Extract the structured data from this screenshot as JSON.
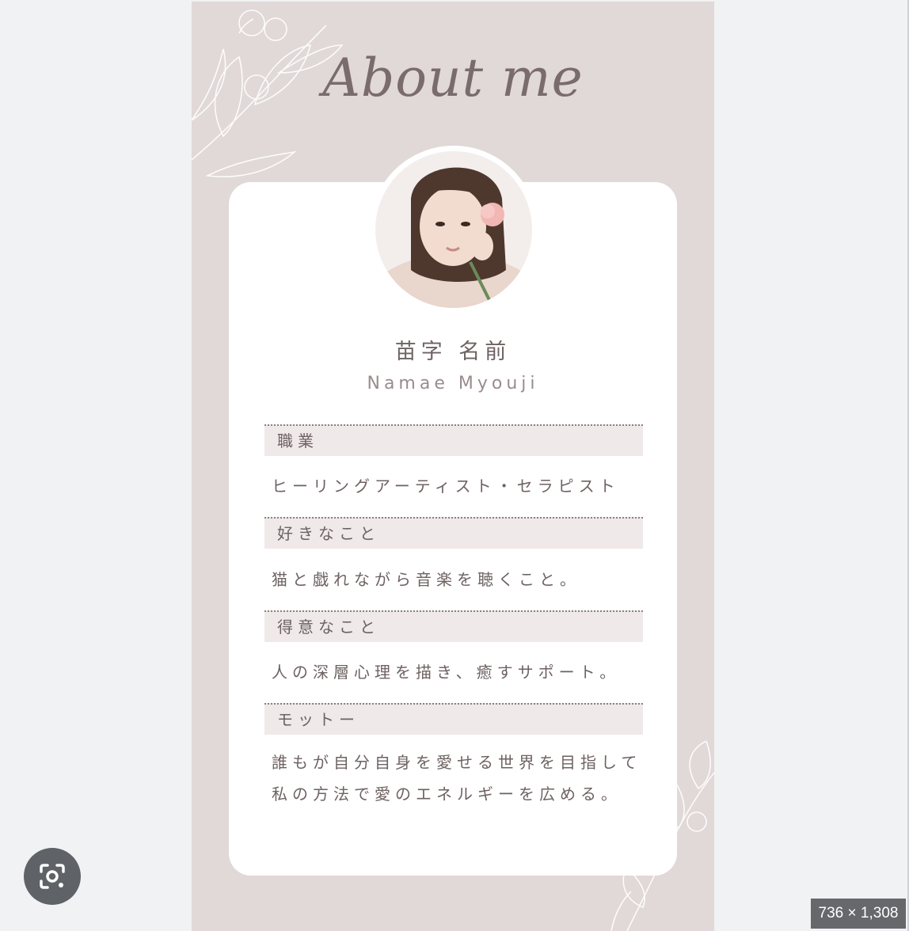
{
  "poster": {
    "title": "About me",
    "name_jp": "苗字 名前",
    "name_en": "Namae Myouji",
    "sections": [
      {
        "heading": "職業",
        "body": [
          "ヒーリングアーティスト・セラピスト"
        ]
      },
      {
        "heading": "好きなこと",
        "body": [
          "猫と戯れながら音楽を聴くこと。"
        ]
      },
      {
        "heading": "得意なこと",
        "body": [
          "人の深層心理を描き、癒すサポート。"
        ]
      },
      {
        "heading": "モットー",
        "body": [
          "誰もが自分自身を愛せる世界を目指して",
          "私の方法で愛のエネルギーを広める。"
        ]
      }
    ]
  },
  "viewer": {
    "dimensions_label": "736 × 1,308",
    "lens_icon": "visual-search-icon"
  },
  "colors": {
    "poster_bg": "#e1d8d8",
    "card_bg": "#ffffff",
    "section_bg": "#efe9e9",
    "text": "#6e6262",
    "page_bg": "#f1f2f4"
  }
}
